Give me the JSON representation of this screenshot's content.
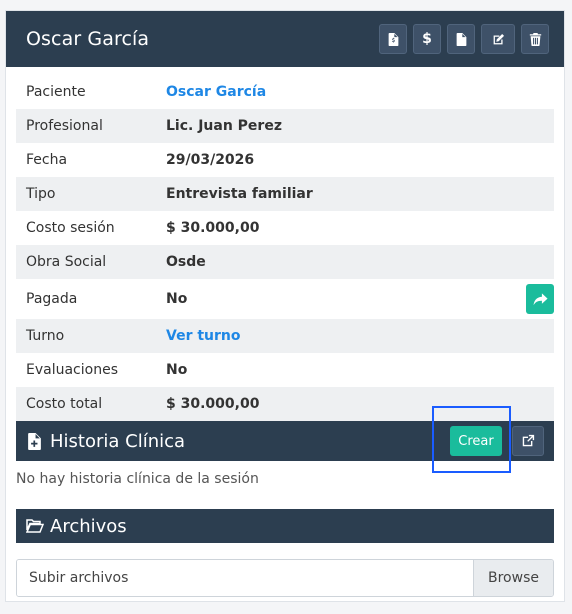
{
  "header": {
    "title": "Oscar García",
    "buttons": [
      {
        "icon": "file-invoice-icon"
      },
      {
        "icon": "dollar-icon",
        "glyph": "$"
      },
      {
        "icon": "document-icon"
      },
      {
        "icon": "edit-icon"
      },
      {
        "icon": "trash-icon"
      }
    ]
  },
  "details": [
    {
      "label": "Paciente",
      "value": "Oscar García"
    },
    {
      "label": "Profesional",
      "value": "Lic. Juan Perez"
    },
    {
      "label": "Fecha",
      "value": "29/03/2026"
    },
    {
      "label": "Tipo",
      "value": "Entrevista familiar"
    },
    {
      "label": "Costo sesión",
      "value": "$ 30.000,00"
    },
    {
      "label": "Obra Social",
      "value": "Osde"
    },
    {
      "label": "Pagada",
      "value": "No"
    },
    {
      "label": "Turno",
      "value": "Ver turno"
    },
    {
      "label": "Evaluaciones",
      "value": "No"
    },
    {
      "label": "Costo total",
      "value": "$ 30.000,00"
    }
  ],
  "historia": {
    "title": "Historia Clínica",
    "create_label": "Crear",
    "empty_message": "No hay historia clínica de la sesión"
  },
  "archivos": {
    "title": "Archivos",
    "upload_placeholder": "Subir archivos",
    "browse_label": "Browse"
  },
  "colors": {
    "header_bg": "#2c3e50",
    "accent_green": "#1abc9c",
    "link_blue": "#1e87e5",
    "highlight_blue": "#1a5cff"
  }
}
